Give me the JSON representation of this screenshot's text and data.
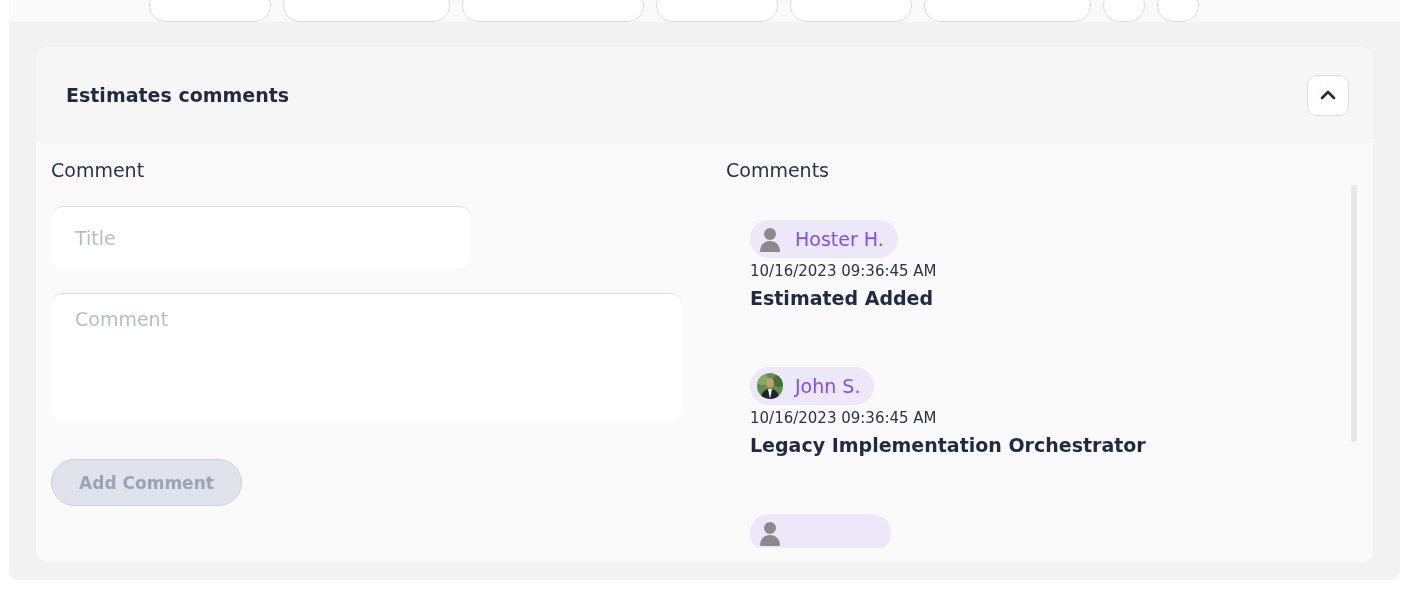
{
  "section": {
    "title": "Estimates comments",
    "expanded": true
  },
  "form": {
    "label": "Comment",
    "title_placeholder": "Title",
    "comment_placeholder": "Comment",
    "submit": {
      "label": "Add Comment",
      "disabled": true
    }
  },
  "comments": {
    "label": "Comments",
    "items": [
      {
        "author": "Hoster H.",
        "kind": "placeholder",
        "time": "10/16/2023 09:36:45 AM",
        "title": "Estimated Added"
      },
      {
        "author": "John S.",
        "time": "10/16/2023 09:36:45 AM",
        "title": "Legacy Implementation Orchestrator"
      },
      {
        "kind": "placeholder"
      }
    ]
  }
}
